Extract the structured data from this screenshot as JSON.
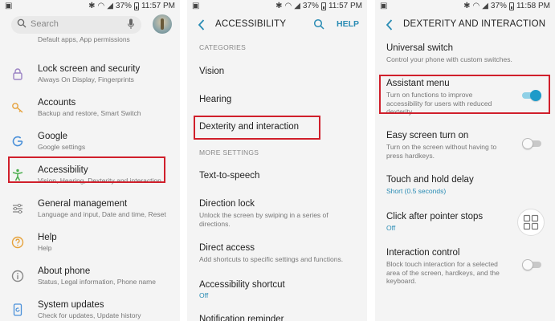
{
  "status": [
    {
      "time": "11:57 PM",
      "battery": "37%"
    },
    {
      "time": "11:57 PM",
      "battery": "37%"
    },
    {
      "time": "11:58 PM",
      "battery": "37%"
    }
  ],
  "settings_panel": {
    "search_placeholder": "Search",
    "items": [
      {
        "title": "",
        "sub": "Default apps, App permissions"
      },
      {
        "title": "Lock screen and security",
        "sub": "Always On Display, Fingerprints"
      },
      {
        "title": "Accounts",
        "sub": "Backup and restore, Smart Switch"
      },
      {
        "title": "Google",
        "sub": "Google settings"
      },
      {
        "title": "Accessibility",
        "sub": "Vision, Hearing, Dexterity and interaction"
      },
      {
        "title": "General management",
        "sub": "Language and input, Date and time, Reset"
      },
      {
        "title": "Help",
        "sub": "Help"
      },
      {
        "title": "About phone",
        "sub": "Status, Legal information, Phone name"
      },
      {
        "title": "System updates",
        "sub": "Check for updates, Update history"
      }
    ]
  },
  "accessibility_panel": {
    "title": "ACCESSIBILITY",
    "help": "HELP",
    "categories_label": "CATEGORIES",
    "categories": [
      "Vision",
      "Hearing",
      "Dexterity and interaction"
    ],
    "more_label": "MORE SETTINGS",
    "more": [
      {
        "title": "Text-to-speech",
        "sub": "",
        "value": ""
      },
      {
        "title": "Direction lock",
        "sub": "Unlock the screen by swiping in a series of directions.",
        "value": ""
      },
      {
        "title": "Direct access",
        "sub": "Add shortcuts to specific settings and functions.",
        "value": ""
      },
      {
        "title": "Accessibility shortcut",
        "sub": "",
        "value": "Off"
      },
      {
        "title": "Notification reminder",
        "sub": "",
        "value": ""
      }
    ]
  },
  "dexterity_panel": {
    "title": "DEXTERITY AND INTERACTION",
    "items": [
      {
        "title": "Universal switch",
        "sub": "Control your phone with custom switches.",
        "value": ""
      },
      {
        "title": "Assistant menu",
        "sub": "Turn on functions to improve accessibility for users with reduced dexterity.",
        "value": "",
        "toggle": true
      },
      {
        "title": "Easy screen turn on",
        "sub": "Turn on the screen without having to press hardkeys.",
        "value": "",
        "toggle": false
      },
      {
        "title": "Touch and hold delay",
        "sub": "",
        "value": "Short (0.5 seconds)"
      },
      {
        "title": "Click after pointer stops",
        "sub": "",
        "value": "Off"
      },
      {
        "title": "Interaction control",
        "sub": "Block touch interaction for a selected area of the screen, hardkeys, and the keyboard.",
        "value": "",
        "toggle": false
      }
    ]
  },
  "colors": {
    "accent": "#2a8cb4",
    "highlight": "#d01f2b",
    "toggle_on": "#1e9bc9"
  }
}
